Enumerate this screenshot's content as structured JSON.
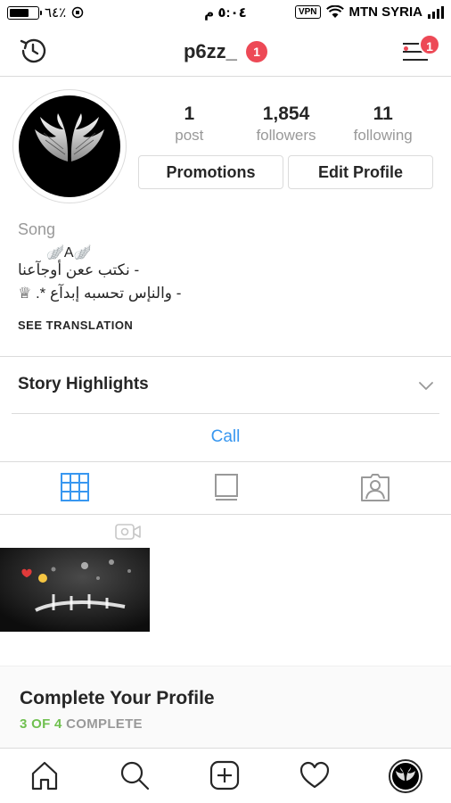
{
  "status_bar": {
    "battery_percent": "٦٤٪",
    "time": "٥:٠٤ م",
    "vpn_label": "VPN",
    "carrier": "MTN SYRIA"
  },
  "header": {
    "username": "p6zz_",
    "notification_count": "1",
    "menu_badge_count": "1"
  },
  "profile": {
    "stats": [
      {
        "value": "1",
        "label": "post"
      },
      {
        "value": "1,854",
        "label": "followers"
      },
      {
        "value": "11",
        "label": "following"
      }
    ],
    "promotions_button": "Promotions",
    "edit_profile_button": "Edit Profile",
    "bio": {
      "category": "Song",
      "name_line": "🪽A🪽",
      "line1": "- نكتب ععن أوجآعنا",
      "line2": "- والنإس تحسبه إبدآع *. ♕"
    },
    "see_translation": "SEE TRANSLATION"
  },
  "story_highlights": {
    "title": "Story Highlights"
  },
  "call_button": "Call",
  "tabs": [
    "grid",
    "feed",
    "tagged"
  ],
  "complete_profile": {
    "title": "Complete Your Profile",
    "done": "3 OF 4",
    "complete_label": "COMPLETE"
  },
  "bottom_nav": [
    "home",
    "search",
    "new-post",
    "activity",
    "profile"
  ],
  "colors": {
    "accent_blue": "#3897f0",
    "badge_red": "#ed4956",
    "progress_green": "#70c050",
    "muted_text": "#999999",
    "border": "#dbdbdb"
  }
}
